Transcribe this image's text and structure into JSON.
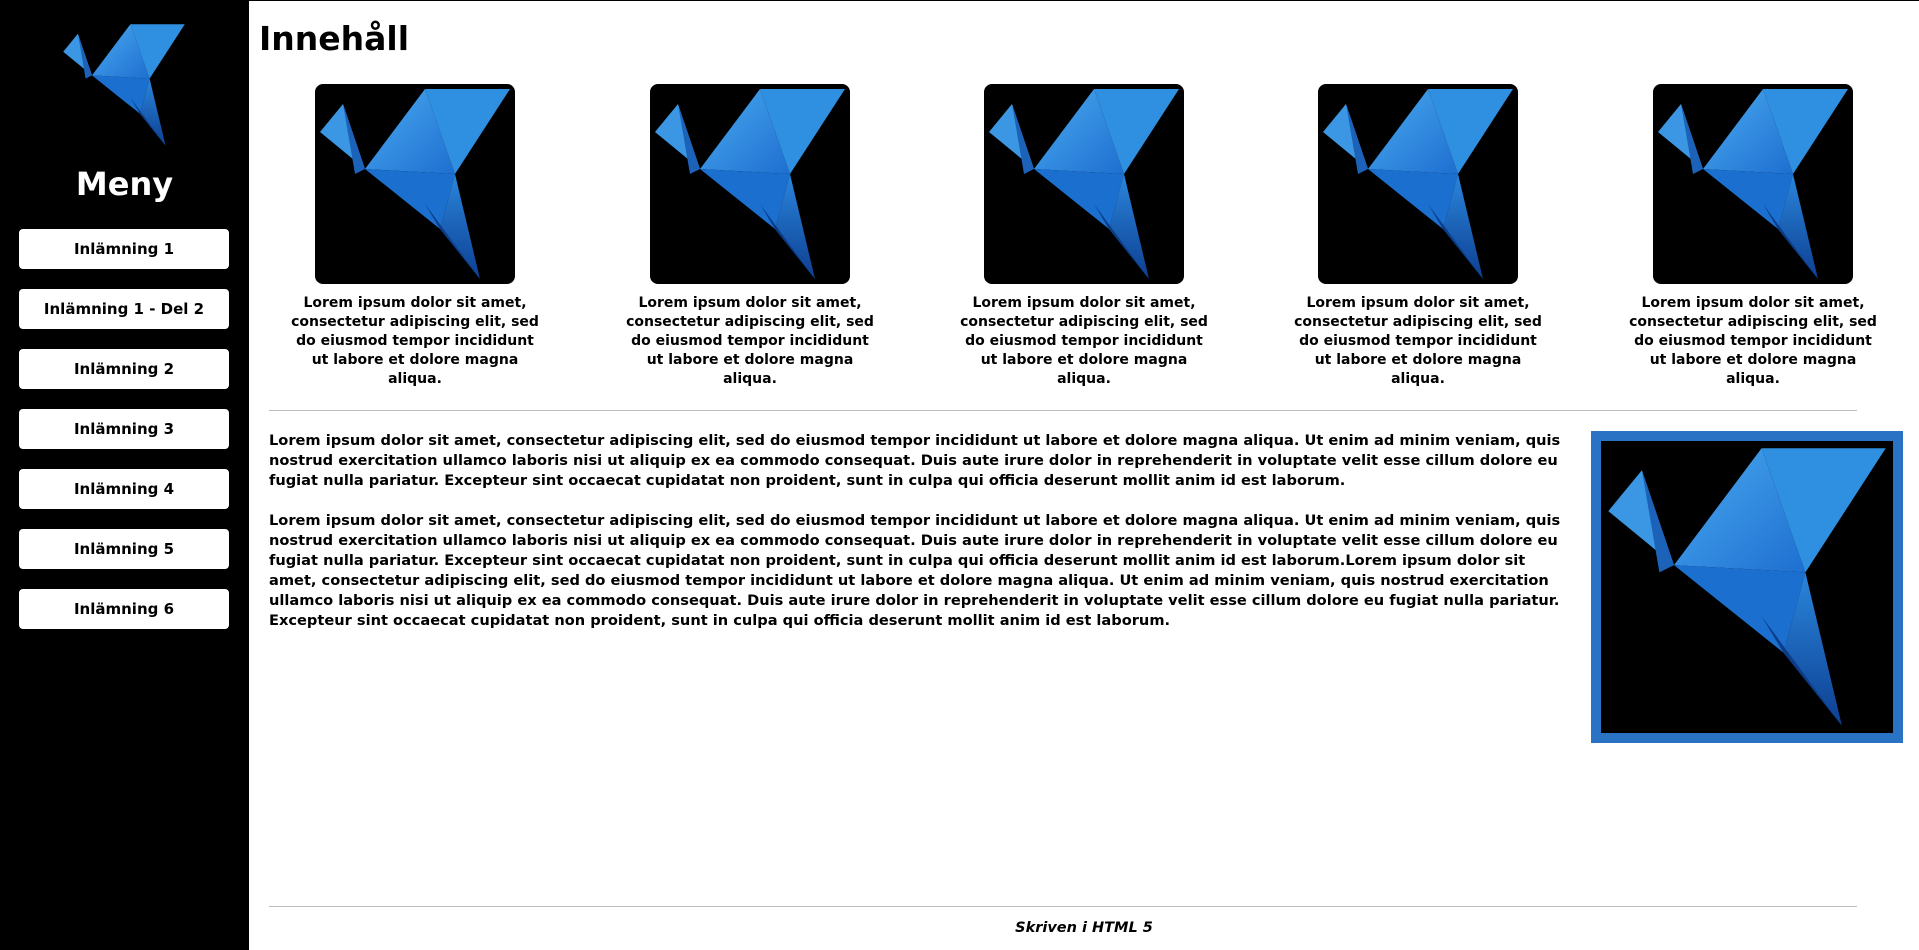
{
  "sidebar": {
    "logo_icon": "origami-bird-icon",
    "title": "Meny",
    "items": [
      {
        "label": "Inlämning 1"
      },
      {
        "label": "Inlämning 1 - Del 2"
      },
      {
        "label": "Inlämning 2"
      },
      {
        "label": "Inlämning 3"
      },
      {
        "label": "Inlämning 4"
      },
      {
        "label": "Inlämning 5"
      },
      {
        "label": "Inlämning 6"
      }
    ]
  },
  "main": {
    "title": "Innehåll",
    "gallery": [
      {
        "icon": "origami-bird-icon",
        "caption": "Lorem ipsum dolor sit amet, consectetur adipiscing elit, sed do eiusmod tempor incididunt ut labore et dolore magna aliqua."
      },
      {
        "icon": "origami-bird-icon",
        "caption": "Lorem ipsum dolor sit amet, consectetur adipiscing elit, sed do eiusmod tempor incididunt ut labore et dolore magna aliqua."
      },
      {
        "icon": "origami-bird-icon",
        "caption": "Lorem ipsum dolor sit amet, consectetur adipiscing elit, sed do eiusmod tempor incididunt ut labore et dolore magna aliqua."
      },
      {
        "icon": "origami-bird-icon",
        "caption": "Lorem ipsum dolor sit amet, consectetur adipiscing elit, sed do eiusmod tempor incididunt ut labore et dolore magna aliqua."
      },
      {
        "icon": "origami-bird-icon",
        "caption": "Lorem ipsum dolor sit amet, consectetur adipiscing elit, sed do eiusmod tempor incididunt ut labore et dolore magna aliqua."
      }
    ],
    "article": {
      "paragraphs": [
        "Lorem ipsum dolor sit amet, consectetur adipiscing elit, sed do eiusmod tempor incididunt ut labore et dolore magna aliqua. Ut enim ad minim veniam, quis nostrud exercitation ullamco laboris nisi ut aliquip ex ea commodo consequat. Duis aute irure dolor in reprehenderit in voluptate velit esse cillum dolore eu fugiat nulla pariatur. Excepteur sint occaecat cupidatat non proident, sunt in culpa qui officia deserunt mollit anim id est laborum.",
        "Lorem ipsum dolor sit amet, consectetur adipiscing elit, sed do eiusmod tempor incididunt ut labore et dolore magna aliqua. Ut enim ad minim veniam, quis nostrud exercitation ullamco laboris nisi ut aliquip ex ea commodo consequat. Duis aute irure dolor in reprehenderit in voluptate velit esse cillum dolore eu fugiat nulla pariatur. Excepteur sint occaecat cupidatat non proident, sunt in culpa qui officia deserunt mollit anim id est laborum.Lorem ipsum dolor sit amet, consectetur adipiscing elit, sed do eiusmod tempor incididunt ut labore et dolore magna aliqua. Ut enim ad minim veniam, quis nostrud exercitation ullamco laboris nisi ut aliquip ex ea commodo consequat. Duis aute irure dolor in reprehenderit in voluptate velit esse cillum dolore eu fugiat nulla pariatur. Excepteur sint occaecat cupidatat non proident, sunt in culpa qui officia deserunt mollit anim id est laborum."
      ],
      "feature_image_icon": "origami-bird-icon"
    },
    "footer": "Skriven i HTML 5"
  },
  "colors": {
    "sidebar_bg": "#000000",
    "accent_blue": "#2a72c4",
    "bird_light": "#3fa0e8",
    "bird_dark": "#0b3f8f"
  }
}
